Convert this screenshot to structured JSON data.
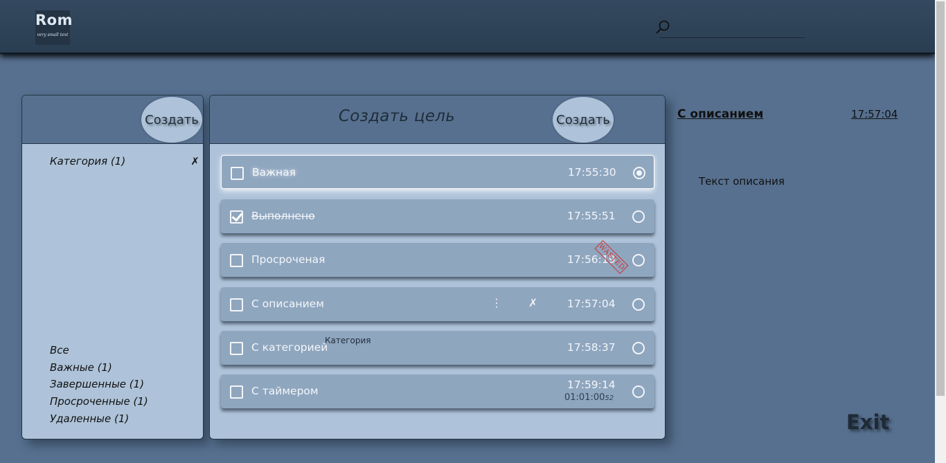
{
  "header": {
    "logo_title": "Rom",
    "logo_subtitle": "very small text",
    "search_value": ""
  },
  "categories_panel": {
    "create_label": "Создать",
    "categories": [
      {
        "label": "Категория (1)",
        "delete_symbol": "✗"
      }
    ],
    "filters": [
      "Все",
      "Важные (1)",
      "Завершенные (1)",
      "Просроченные (1)",
      "Удаленные (1)"
    ]
  },
  "goals_panel": {
    "title": "Создать цель",
    "create_label": "Создать",
    "tasks": [
      {
        "label": "Важная",
        "time": "17:55:30",
        "checked": false,
        "selected": true
      },
      {
        "label": "Выполнено",
        "time": "17:55:51",
        "checked": true
      },
      {
        "label": "Просроченая",
        "time": "17:56:19",
        "stamp": "WASTED"
      },
      {
        "label": "С описанием",
        "time": "17:57:04",
        "menu_symbol": "⋮",
        "delete_symbol": "✗"
      },
      {
        "label": "С категорией",
        "time": "17:58:37",
        "category": "Категория"
      },
      {
        "label": "С таймером",
        "time": "17:59:14",
        "timer": "01:01:00",
        "timer_ms": "52"
      }
    ]
  },
  "detail": {
    "title": "С описанием",
    "time": "17:57:04",
    "description": "Текст описания"
  },
  "exit_label": "Exit",
  "colors": {
    "background": "#57708f",
    "header": "#2f4459",
    "panel": "#aec3d9",
    "task": "#8fa6bf",
    "stamp": "#d0302f"
  }
}
